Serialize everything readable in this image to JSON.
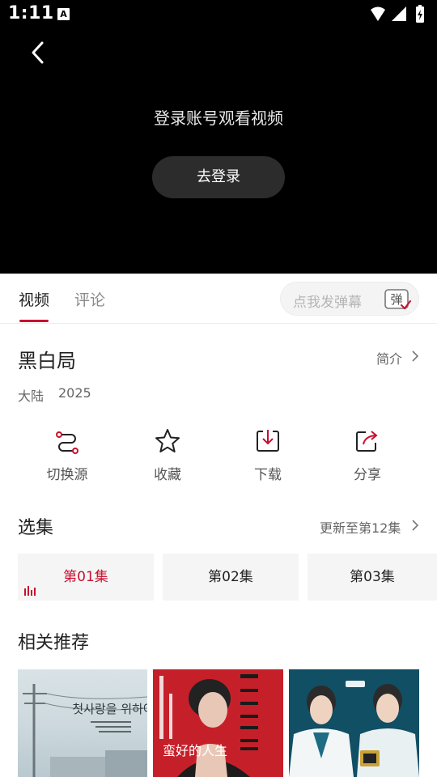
{
  "status_bar": {
    "time": "1:11",
    "badge": "A"
  },
  "video": {
    "login_prompt": "登录账号观看视频",
    "login_button": "去登录"
  },
  "tabs": [
    {
      "label": "视频",
      "active": true
    },
    {
      "label": "评论",
      "active": false
    }
  ],
  "danmu": {
    "placeholder": "点我发弹幕",
    "icon_label": "弹"
  },
  "show": {
    "title": "黑白局",
    "intro_link": "简介",
    "region": "大陆",
    "year": "2025"
  },
  "actions": [
    {
      "label": "切换源",
      "icon": "switch-source-icon"
    },
    {
      "label": "收藏",
      "icon": "star-icon"
    },
    {
      "label": "下载",
      "icon": "download-icon"
    },
    {
      "label": "分享",
      "icon": "share-icon"
    }
  ],
  "episodes": {
    "title": "选集",
    "update_link": "更新至第12集",
    "items": [
      {
        "label": "第01集",
        "active": true
      },
      {
        "label": "第02集",
        "active": false
      },
      {
        "label": "第03集",
        "active": false
      }
    ]
  },
  "recommend": {
    "title": "相关推荐",
    "posters": [
      {
        "title_text": "첫사랑을 위하여"
      },
      {
        "title_text": "蛮好的人生"
      },
      {
        "title_text": ""
      }
    ]
  },
  "colors": {
    "accent": "#c8102e",
    "video_bg": "#000000",
    "button_bg": "#2c2c2c"
  }
}
